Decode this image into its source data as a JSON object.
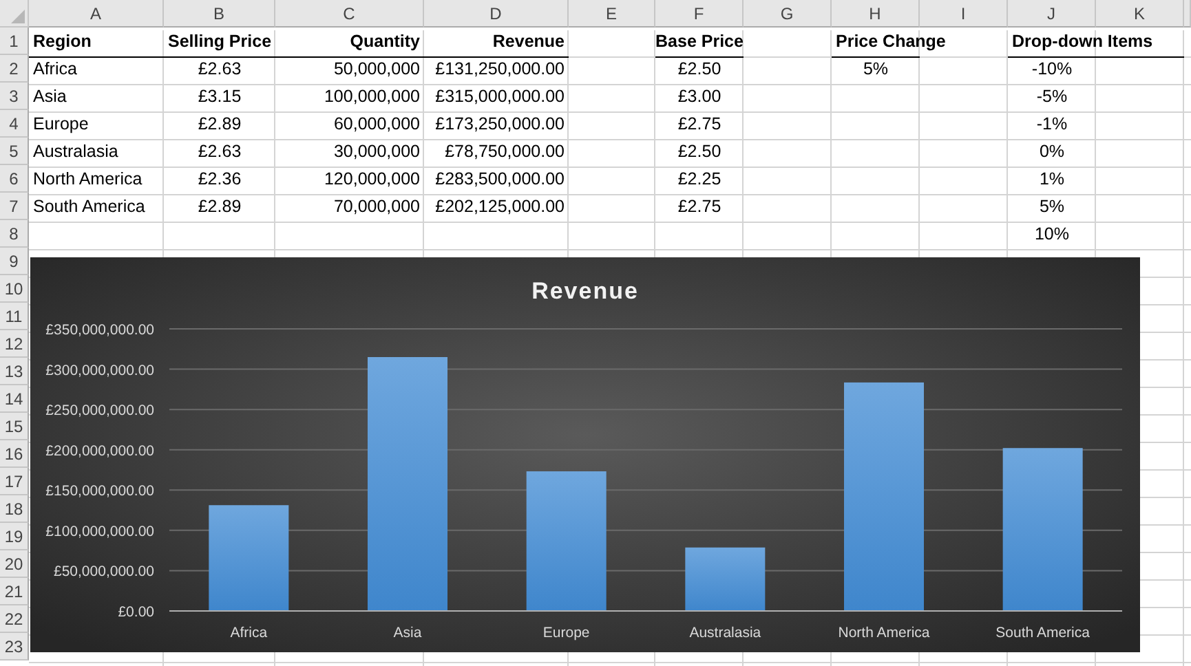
{
  "columns": [
    "A",
    "B",
    "C",
    "D",
    "E",
    "F",
    "G",
    "H",
    "I",
    "J",
    "K"
  ],
  "rows": [
    {
      "number": "1",
      "kind": "header",
      "cells": [
        "Region",
        "Selling Price",
        "Quantity",
        "Revenue",
        "",
        "Base Price",
        "",
        "Price Change",
        "",
        "Drop-down Items",
        ""
      ]
    },
    {
      "number": "2",
      "cells": [
        "Africa",
        "£2.63",
        "50,000,000",
        "£131,250,000.00",
        "",
        "£2.50",
        "",
        "5%",
        "",
        "-10%",
        ""
      ]
    },
    {
      "number": "3",
      "cells": [
        "Asia",
        "£3.15",
        "100,000,000",
        "£315,000,000.00",
        "",
        "£3.00",
        "",
        "",
        "",
        "-5%",
        ""
      ]
    },
    {
      "number": "4",
      "cells": [
        "Europe",
        "£2.89",
        "60,000,000",
        "£173,250,000.00",
        "",
        "£2.75",
        "",
        "",
        "",
        "-1%",
        ""
      ]
    },
    {
      "number": "5",
      "cells": [
        "Australasia",
        "£2.63",
        "30,000,000",
        "£78,750,000.00",
        "",
        "£2.50",
        "",
        "",
        "",
        "0%",
        ""
      ]
    },
    {
      "number": "6",
      "cells": [
        "North America",
        "£2.36",
        "120,000,000",
        "£283,500,000.00",
        "",
        "£2.25",
        "",
        "",
        "",
        "1%",
        ""
      ]
    },
    {
      "number": "7",
      "cells": [
        "South America",
        "£2.89",
        "70,000,000",
        "£202,125,000.00",
        "",
        "£2.75",
        "",
        "",
        "",
        "5%",
        ""
      ]
    },
    {
      "number": "8",
      "cells": [
        "",
        "",
        "",
        "",
        "",
        "",
        "",
        "",
        "",
        "10%",
        ""
      ]
    },
    {
      "number": "9"
    },
    {
      "number": "10"
    },
    {
      "number": "11"
    },
    {
      "number": "12"
    },
    {
      "number": "13"
    },
    {
      "number": "14"
    },
    {
      "number": "15"
    },
    {
      "number": "16"
    },
    {
      "number": "17"
    },
    {
      "number": "18"
    },
    {
      "number": "19"
    },
    {
      "number": "20"
    },
    {
      "number": "21"
    },
    {
      "number": "22"
    },
    {
      "number": "23"
    }
  ],
  "chart": {
    "chart_data": {
      "type": "bar",
      "title": "Revenue",
      "categories": [
        "Africa",
        "Asia",
        "Europe",
        "Australasia",
        "North America",
        "South America"
      ],
      "grid": true,
      "series": [
        {
          "color": "#5b9bd5",
          "values": [
            131250000,
            315000000,
            173250000,
            78750000,
            283500000,
            202125000
          ]
        }
      ],
      "ylim": [
        0,
        350000000
      ],
      "yticks": [
        {
          "value": 0,
          "label": "£0.00"
        },
        {
          "value": 50000000,
          "label": "£50,000,000.00"
        },
        {
          "value": 100000000,
          "label": "£100,000,000.00"
        },
        {
          "value": 150000000,
          "label": "£150,000,000.00"
        },
        {
          "value": 200000000,
          "label": "£200,000,000.00"
        },
        {
          "value": 250000000,
          "label": "£250,000,000.00"
        },
        {
          "value": 300000000,
          "label": "£300,000,000.00"
        },
        {
          "value": 350000000,
          "label": "£350,000,000.00"
        }
      ]
    }
  }
}
